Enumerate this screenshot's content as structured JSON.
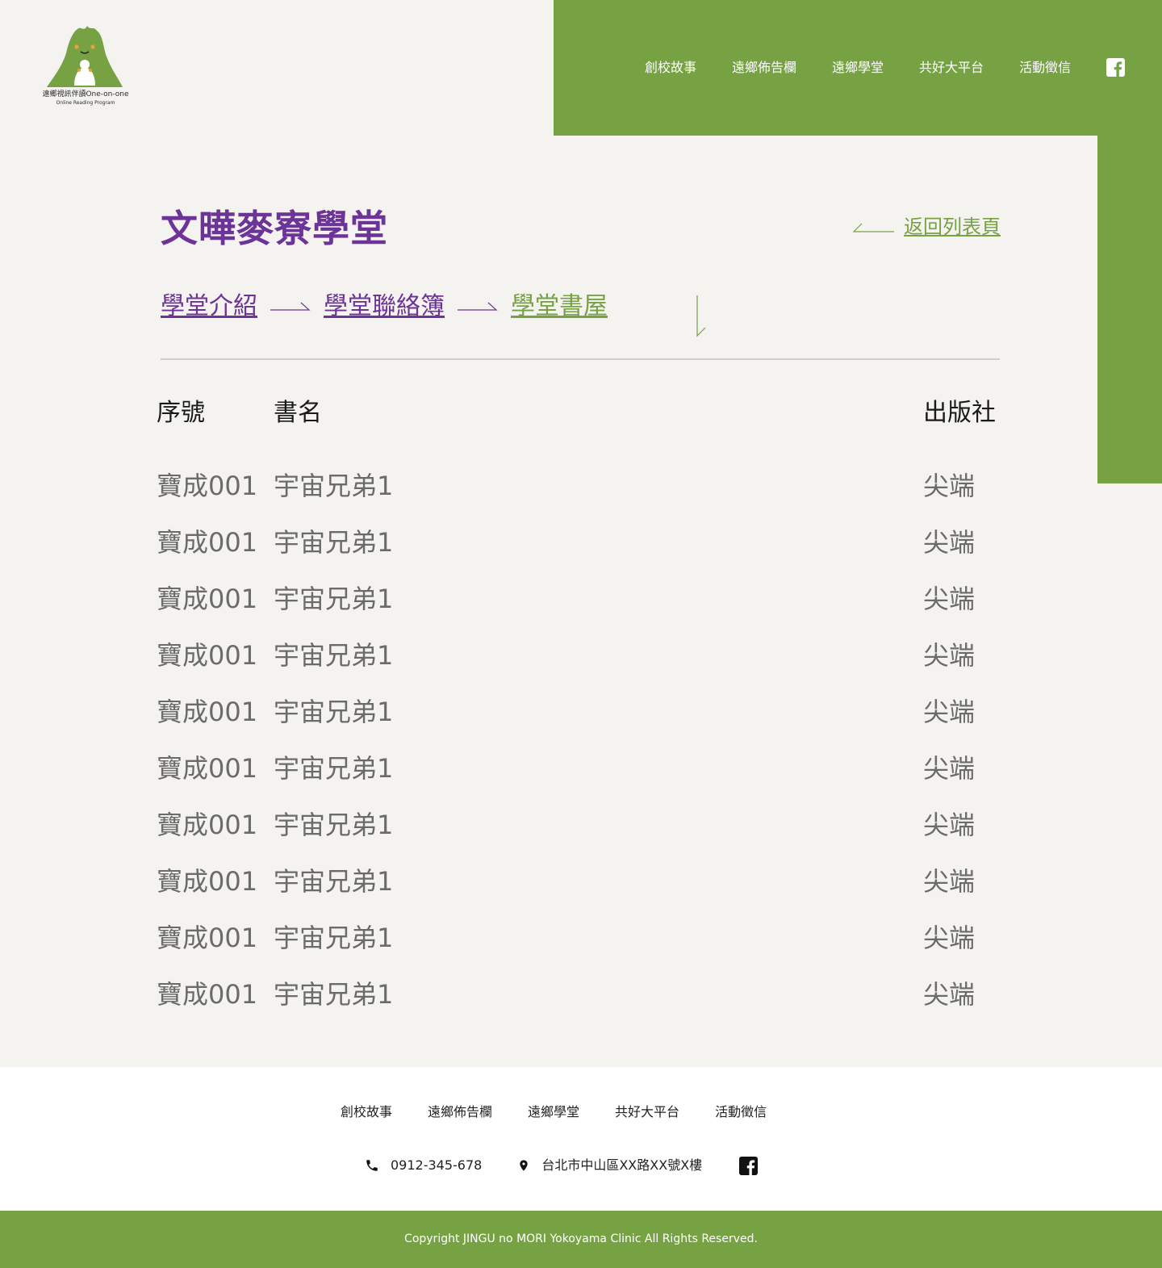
{
  "colors": {
    "brand_green": "#76a244",
    "accent_purple": "#6d3497",
    "background": "#f4f3f0",
    "text_gray": "#6b6b6b"
  },
  "logo": {
    "name": "遠鄉視訊伴讀One-on-one",
    "subtitle": "Online Reading Program"
  },
  "nav": {
    "items": [
      "創校故事",
      "遠鄉佈告欄",
      "遠鄉學堂",
      "共好大平台",
      "活動徵信"
    ],
    "social_icon": "facebook-icon"
  },
  "page": {
    "title": "文曄麥寮學堂",
    "back_link": "返回列表頁"
  },
  "tabs": [
    {
      "label": "學堂介紹",
      "active": false
    },
    {
      "label": "學堂聯絡簿",
      "active": false
    },
    {
      "label": "學堂書屋",
      "active": true
    }
  ],
  "table": {
    "headers": {
      "serial": "序號",
      "title": "書名",
      "publisher": "出版社"
    },
    "rows": [
      {
        "serial": "寶成001",
        "title": "宇宙兄弟1",
        "publisher": "尖端"
      },
      {
        "serial": "寶成001",
        "title": "宇宙兄弟1",
        "publisher": "尖端"
      },
      {
        "serial": "寶成001",
        "title": "宇宙兄弟1",
        "publisher": "尖端"
      },
      {
        "serial": "寶成001",
        "title": "宇宙兄弟1",
        "publisher": "尖端"
      },
      {
        "serial": "寶成001",
        "title": "宇宙兄弟1",
        "publisher": "尖端"
      },
      {
        "serial": "寶成001",
        "title": "宇宙兄弟1",
        "publisher": "尖端"
      },
      {
        "serial": "寶成001",
        "title": "宇宙兄弟1",
        "publisher": "尖端"
      },
      {
        "serial": "寶成001",
        "title": "宇宙兄弟1",
        "publisher": "尖端"
      },
      {
        "serial": "寶成001",
        "title": "宇宙兄弟1",
        "publisher": "尖端"
      },
      {
        "serial": "寶成001",
        "title": "宇宙兄弟1",
        "publisher": "尖端"
      }
    ]
  },
  "footer": {
    "nav": [
      "創校故事",
      "遠鄉佈告欄",
      "遠鄉學堂",
      "共好大平台",
      "活動徵信"
    ],
    "phone": "0912-345-678",
    "address": "台北市中山區XX路XX號X樓",
    "icons": [
      "phone-icon",
      "location-pin-icon",
      "facebook-icon"
    ],
    "copyright": "Copyright JINGU no MORI Yokoyama Clinic All Rights Reserved."
  }
}
